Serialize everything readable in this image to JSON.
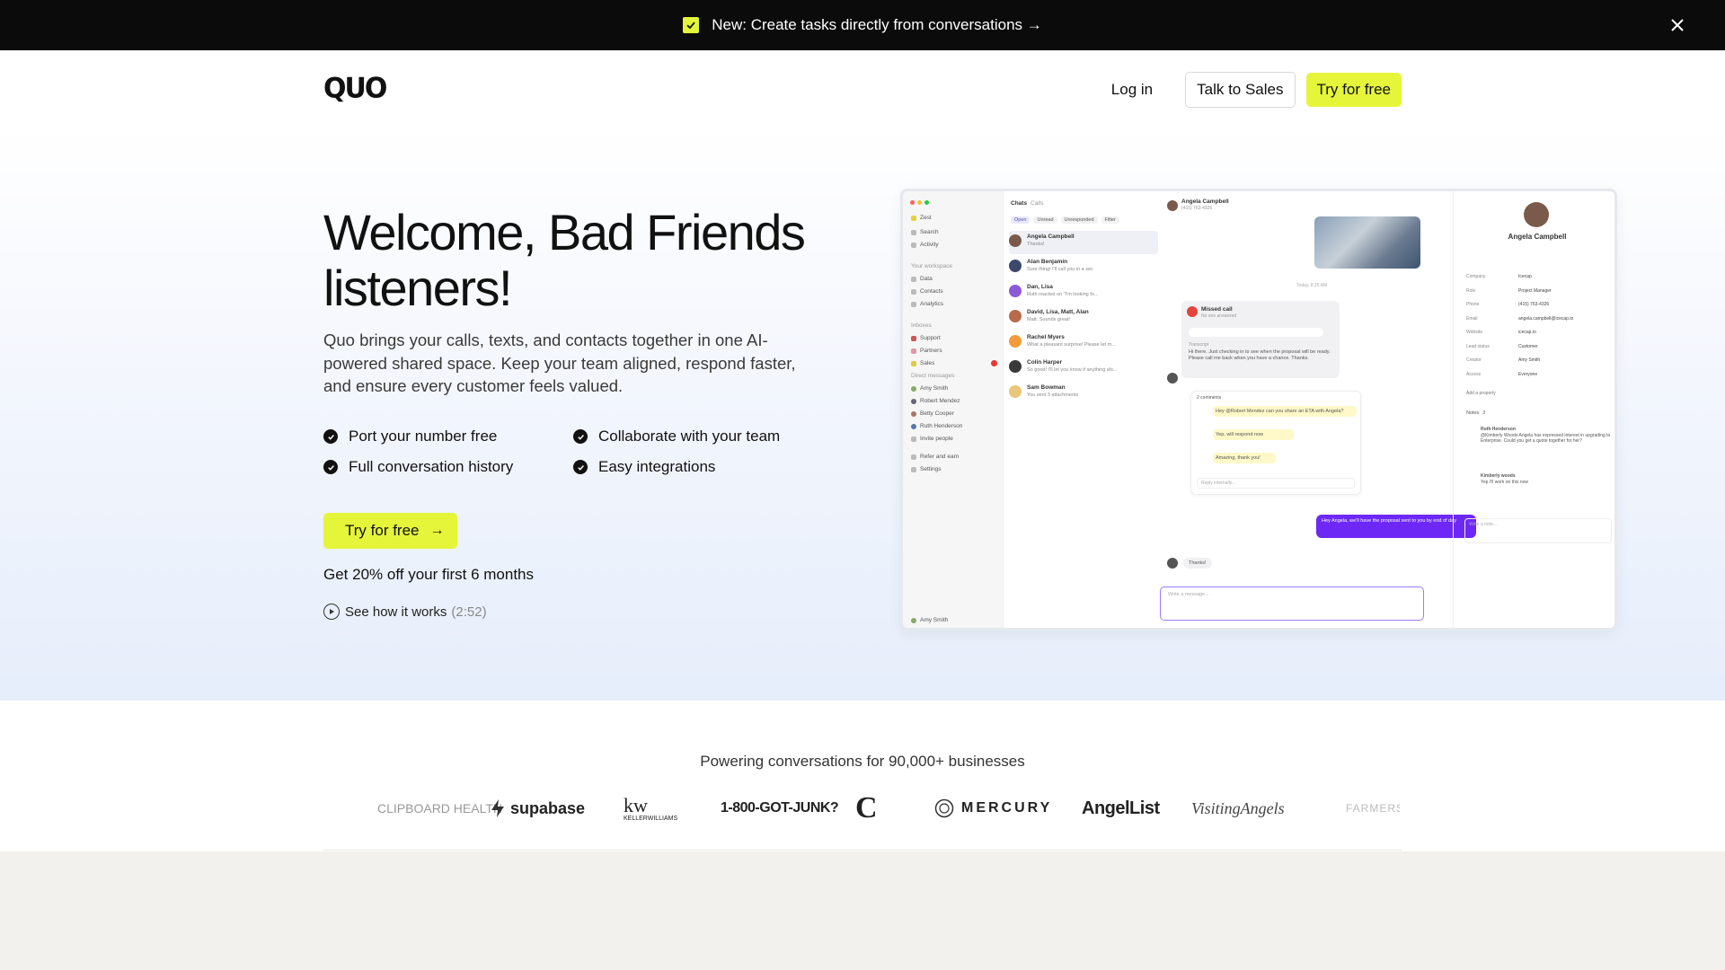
{
  "announcement": {
    "text": "New: Create tasks directly from conversations →",
    "icon": "checkbox-icon",
    "close_icon": "close-icon"
  },
  "header": {
    "logo": "QUO",
    "login": "Log in",
    "talk_to_sales": "Talk to Sales",
    "try_free": "Try for free"
  },
  "hero": {
    "title": "Welcome, Bad Friends listeners!",
    "description": "Quo brings your calls, texts, and contacts together in one AI-powered shared space. Keep your team aligned, respond faster, and ensure every customer feels valued.",
    "features": [
      "Port your number free",
      "Collaborate with your team",
      "Full conversation history",
      "Easy integrations"
    ],
    "cta": "Try for free",
    "promo": "Get 20% off your first 6 months",
    "video_link": "See how it works",
    "video_duration": "(2:52)"
  },
  "mockup": {
    "sidebar_items": [
      "Zest",
      "Search",
      "Activity",
      "Your workspace",
      "Data",
      "Contacts",
      "Analytics",
      "Inboxes",
      "Support",
      "Partners",
      "Sales",
      "Direct messages",
      "Amy Smith",
      "Robert Mendez",
      "Betty Cooper",
      "Ruth Henderson",
      "Invite people",
      "Refer and earn",
      "Settings",
      "Amy Smith"
    ],
    "tabs": [
      "Chats",
      "Calls"
    ],
    "filters": [
      "Open",
      "Unread",
      "Unresponded",
      "Filter"
    ],
    "conversations": [
      {
        "name": "Angela Campbell",
        "preview": "Thanks!"
      },
      {
        "name": "Alan Benjamin",
        "preview": "Sure thing! I'll call you in a sec"
      },
      {
        "name": "Dan, Lisa",
        "preview": "Ruth reacted on \"I'm looking fo..."
      },
      {
        "name": "David, Lisa, Matt, Alan",
        "preview": "Matt: Sounds great!"
      },
      {
        "name": "Rachel Myers",
        "preview": "What a pleasant surprise! Please let m..."
      },
      {
        "name": "Colin Harper",
        "preview": "So good! I'll let you know if anything els..."
      },
      {
        "name": "Sam Bowman",
        "preview": "You sent 3 attachments"
      }
    ],
    "chat_contact": "Angela Campbell",
    "chat_phone": "(415) 763-4326",
    "date_label": "Today, 8:26 AM",
    "missed_call": "Missed call",
    "missed_call_sub": "No one answered",
    "voicemail_label": "Transcript",
    "voicemail": "Hi there. Just checking in to see when the proposal will be ready. Please call me back when you have a chance. Thanks.",
    "thread_label": "2 comments",
    "thread": [
      {
        "text": "Hey @Robert Mendez can you share an ETA with Angela?"
      },
      {
        "text": "Yep, will respond now"
      },
      {
        "text": "Amazing, thank you!"
      }
    ],
    "reply_placeholder": "Reply internally...",
    "outgoing": "Hey Angela, we'll have the proposal sent to you by end of day",
    "thanks": "Thanks!",
    "composer_placeholder": "Write a message...",
    "contact": {
      "name": "Angela Campbell",
      "fields": [
        {
          "label": "Company",
          "value": "Icecap"
        },
        {
          "label": "Role",
          "value": "Project Manager"
        },
        {
          "label": "Phone",
          "value": "(415) 763-4326"
        },
        {
          "label": "Email",
          "value": "angela.campbell@icecap.io"
        },
        {
          "label": "Website",
          "value": "icecap.io"
        },
        {
          "label": "Lead status",
          "value": "Customer"
        },
        {
          "label": "Creator",
          "value": "Amy Smith"
        },
        {
          "label": "Access",
          "value": "Everyone"
        }
      ],
      "add_property": "Add a property",
      "notes_label": "Notes",
      "notes_count": "2",
      "notes": [
        {
          "author": "Ruth Henderson",
          "text": "@Kimberly Woods Angela has expressed interest in upgrading to Enterprise. Could you get a quote together for her?"
        },
        {
          "author": "Kimberly woods",
          "text": "Yep I'll work on this now"
        }
      ],
      "note_placeholder": "Write a note..."
    }
  },
  "logos": {
    "title": "Powering conversations for 90,000+ businesses",
    "brands": [
      "CLIPBOARD HEALTH",
      "supabase",
      "kw",
      "KELLERWILLIAMS",
      "1-800-GOT-JUNK?",
      "C",
      "MERCURY",
      "AngelList",
      "VisitingAngels",
      "FARMERS"
    ]
  },
  "colors": {
    "accent": "#e5f53a",
    "dark": "#0b0b0b",
    "purple": "#6d28f5"
  }
}
